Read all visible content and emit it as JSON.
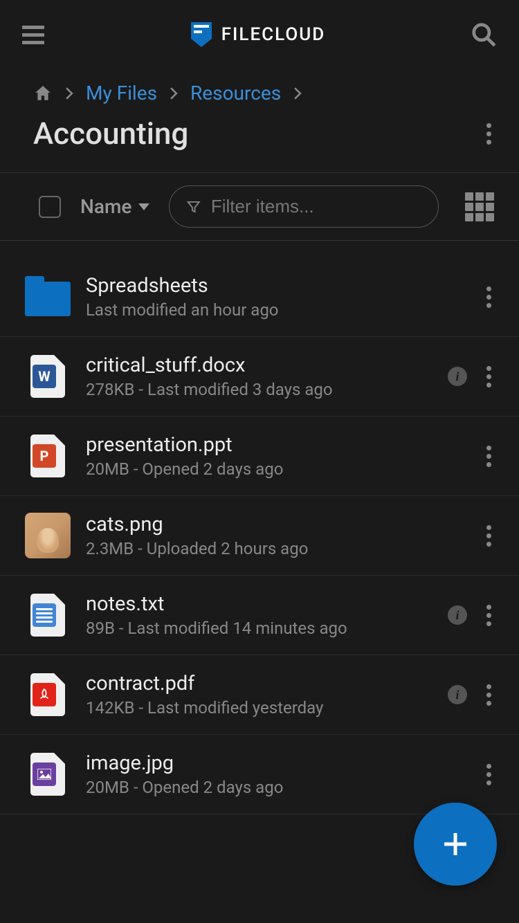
{
  "app": {
    "name": "FILECLOUD"
  },
  "breadcrumb": {
    "items": [
      "My Files",
      "Resources"
    ]
  },
  "page": {
    "title": "Accounting"
  },
  "toolbar": {
    "sort_label": "Name",
    "filter_placeholder": "Filter items..."
  },
  "files": [
    {
      "name": "Spreadsheets",
      "meta": "Last modified an hour ago",
      "type": "folder",
      "has_info": false
    },
    {
      "name": "critical_stuff.docx",
      "meta": "278KB - Last modified 3 days ago",
      "type": "docx",
      "has_info": true
    },
    {
      "name": "presentation.ppt",
      "meta": "20MB - Opened 2 days ago",
      "type": "ppt",
      "has_info": false
    },
    {
      "name": "cats.png",
      "meta": "2.3MB - Uploaded 2 hours ago",
      "type": "image_thumb",
      "has_info": false
    },
    {
      "name": "notes.txt",
      "meta": "89B - Last modified 14 minutes ago",
      "type": "txt",
      "has_info": true
    },
    {
      "name": "contract.pdf",
      "meta": "142KB - Last modified yesterday",
      "type": "pdf",
      "has_info": true
    },
    {
      "name": "image.jpg",
      "meta": "20MB - Opened 2 days ago",
      "type": "jpg",
      "has_info": false
    }
  ],
  "colors": {
    "accent": "#0d6fbf",
    "link": "#3b8fd9"
  }
}
